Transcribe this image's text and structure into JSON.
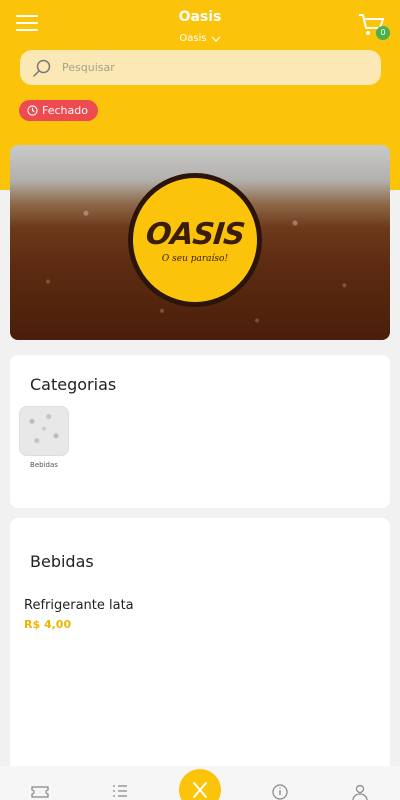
{
  "header": {
    "title": "Oasis",
    "store": "Oasis",
    "cart_count": "0"
  },
  "search": {
    "placeholder": "Pesquisar"
  },
  "status": {
    "label": "Fechado"
  },
  "banner": {
    "logo_text": "OASIS",
    "tagline": "O seu paraíso!"
  },
  "categories": {
    "title": "Categorias",
    "items": [
      {
        "label": "Bebidas"
      }
    ]
  },
  "products": {
    "section_title": "Bebidas",
    "items": [
      {
        "name": "Refrigerante lata",
        "price": "R$ 4,00"
      }
    ]
  },
  "nav": {
    "items": [
      {
        "icon": "ticket-icon"
      },
      {
        "icon": "list-icon"
      },
      {
        "icon": "cutlery-icon"
      },
      {
        "icon": "info-icon"
      },
      {
        "icon": "user-icon"
      }
    ]
  },
  "colors": {
    "accent": "#fbc40a",
    "status": "#ee4b50",
    "badge": "#4caf50",
    "price": "#f0b400"
  }
}
